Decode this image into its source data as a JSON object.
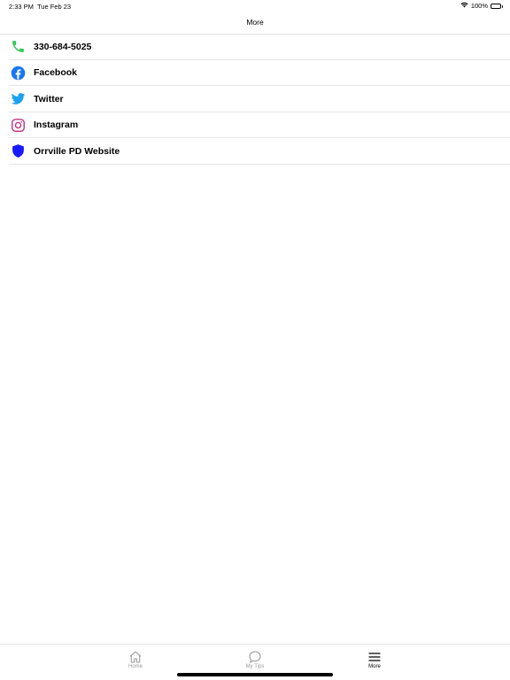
{
  "status_bar": {
    "time": "2:33 PM",
    "date": "Tue Feb 23",
    "battery": "100%"
  },
  "header": {
    "title": "More"
  },
  "items": [
    {
      "label": "330-684-5025",
      "icon": "phone-icon",
      "color": "#34c759"
    },
    {
      "label": "Facebook",
      "icon": "facebook-icon",
      "color": "#1877f2"
    },
    {
      "label": "Twitter",
      "icon": "twitter-icon",
      "color": "#1da1f2"
    },
    {
      "label": "Instagram",
      "icon": "instagram-icon",
      "color": "#c13584"
    },
    {
      "label": "Orrville PD Website",
      "icon": "shield-icon",
      "color": "#1a1aff"
    }
  ],
  "tabs": [
    {
      "label": "Home",
      "icon": "home-icon",
      "active": false
    },
    {
      "label": "My Tips",
      "icon": "chat-bubble-icon",
      "active": false
    },
    {
      "label": "More",
      "icon": "menu-icon",
      "active": true
    }
  ]
}
